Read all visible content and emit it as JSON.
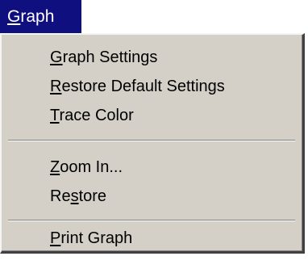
{
  "menu": {
    "title": {
      "accel": "G",
      "rest": "raph"
    },
    "items": [
      {
        "accel_before": "",
        "accel": "G",
        "rest": "raph Settings"
      },
      {
        "accel_before": "",
        "accel": "R",
        "rest": "estore Default Settings"
      },
      {
        "accel_before": "",
        "accel": "T",
        "rest": "race Color"
      },
      {
        "accel_before": "",
        "accel": "Z",
        "rest": "oom In..."
      },
      {
        "accel_before": "Re",
        "accel": "s",
        "rest": "tore"
      },
      {
        "accel_before": "",
        "accel": "P",
        "rest": "rint Graph"
      }
    ]
  },
  "colors": {
    "menu_title_bg": "#0f0f80",
    "menu_title_fg": "#ffffff",
    "menu_bg": "#d4d0c8",
    "menu_fg": "#000000"
  }
}
